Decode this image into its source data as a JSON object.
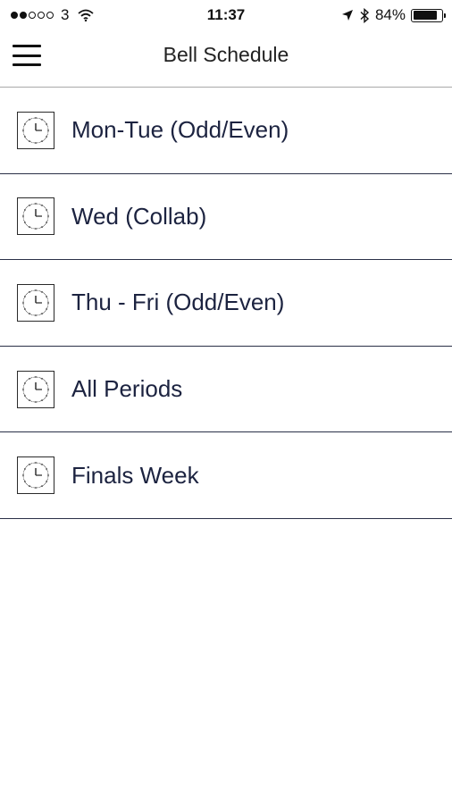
{
  "status_bar": {
    "carrier": "3",
    "time": "11:37",
    "battery": "84%",
    "battery_level": 0.84,
    "icons": [
      "signal-dots",
      "wifi-icon",
      "location-arrow-icon",
      "bluetooth-icon",
      "battery-icon"
    ]
  },
  "nav": {
    "title": "Bell Schedule",
    "menu_icon": "hamburger-menu-icon"
  },
  "schedules": [
    {
      "label": "Mon-Tue (Odd/Even)",
      "icon": "clock-icon"
    },
    {
      "label": "Wed (Collab)",
      "icon": "clock-icon"
    },
    {
      "label": "Thu - Fri (Odd/Even)",
      "icon": "clock-icon"
    },
    {
      "label": "All Periods",
      "icon": "clock-icon"
    },
    {
      "label": "Finals Week",
      "icon": "clock-icon"
    }
  ],
  "colors": {
    "text": "#1c2340",
    "divider": "#2a3047",
    "background": "#ffffff"
  }
}
